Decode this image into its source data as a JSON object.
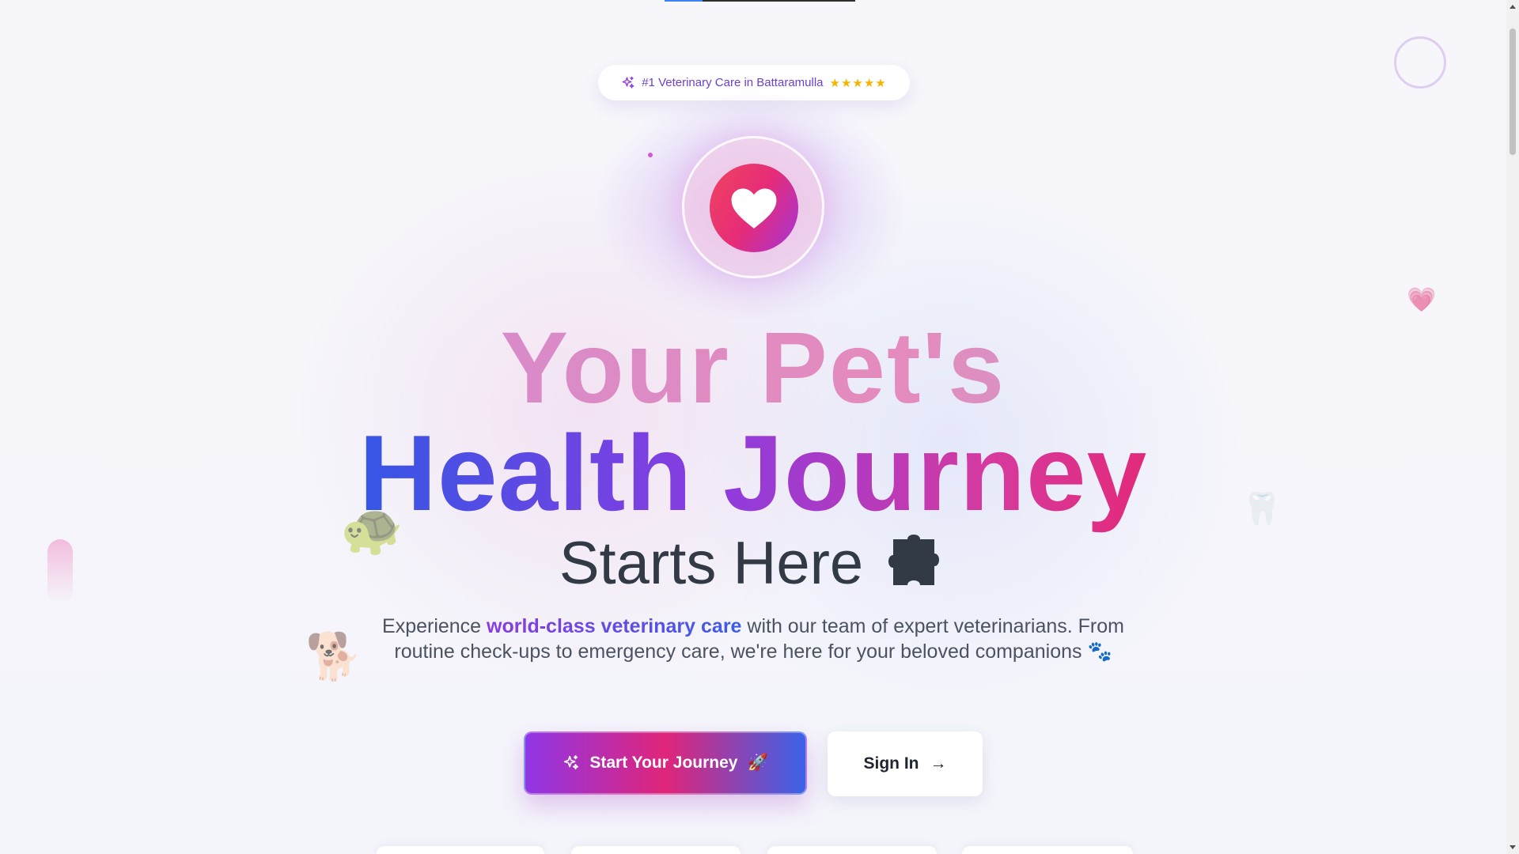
{
  "badge": {
    "icon": "sparkles-icon",
    "text": "#1 Veterinary Care in Battaramulla",
    "stars": "★★★★★"
  },
  "hero": {
    "emblem_icon": "heart-icon",
    "line1": "Your Pet's",
    "line2": "Health Journey",
    "line3": "Starts Here",
    "line3_icon": "puzzle-icon"
  },
  "description": {
    "before": "Experience ",
    "highlight": "world-class veterinary care",
    "after": " with our team of expert veterinarians. From routine check-ups to emergency care, we're here for your beloved companions ",
    "emoji": "🐾"
  },
  "buttons": {
    "primary_label": "Start Your Journey",
    "primary_emoji": "🚀",
    "secondary_label": "Sign In",
    "secondary_arrow": "→"
  },
  "decorations": {
    "turtle": "🐢",
    "dog": "🐕",
    "heart": "💗",
    "tooth": "🦷"
  },
  "colors": {
    "accent_purple": "#8b3be0",
    "accent_pink": "#e22a7a",
    "accent_blue": "#3556e6",
    "star_gold": "#f5b400"
  }
}
